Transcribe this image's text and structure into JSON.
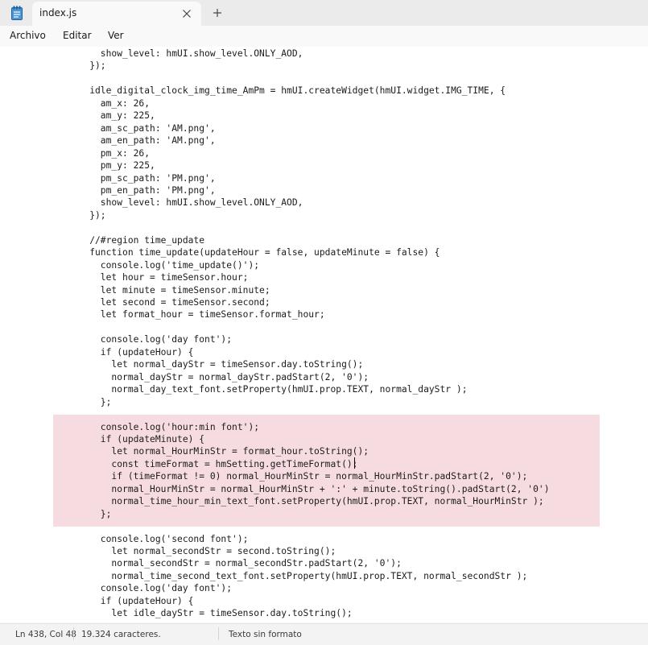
{
  "tab": {
    "title": "index.js"
  },
  "menu": {
    "items": [
      "Archivo",
      "Editar",
      "Ver"
    ]
  },
  "editor": {
    "lines": [
      "      show_level: hmUI.show_level.ONLY_AOD,",
      "    });",
      "",
      "    idle_digital_clock_img_time_AmPm = hmUI.createWidget(hmUI.widget.IMG_TIME, {",
      "      am_x: 26,",
      "      am_y: 225,",
      "      am_sc_path: 'AM.png',",
      "      am_en_path: 'AM.png',",
      "      pm_x: 26,",
      "      pm_y: 225,",
      "      pm_sc_path: 'PM.png',",
      "      pm_en_path: 'PM.png',",
      "      show_level: hmUI.show_level.ONLY_AOD,",
      "    });",
      "",
      "    //#region time_update",
      "    function time_update(updateHour = false, updateMinute = false) {",
      "      console.log('time_update()');",
      "      let hour = timeSensor.hour;",
      "      let minute = timeSensor.minute;",
      "      let second = timeSensor.second;",
      "      let format_hour = timeSensor.format_hour;",
      "",
      "      console.log('day font');",
      "      if (updateHour) {",
      "        let normal_dayStr = timeSensor.day.toString();",
      "        normal_dayStr = normal_dayStr.padStart(2, '0');",
      "        normal_day_text_font.setProperty(hmUI.prop.TEXT, normal_dayStr );",
      "      };",
      "",
      "      console.log('hour:min font');",
      "      if (updateMinute) {",
      "        let normal_HourMinStr = format_hour.toString();",
      "        const timeFormat = hmSetting.getTimeFormat();",
      "        if (timeFormat != 0) normal_HourMinStr = normal_HourMinStr.padStart(2, '0');",
      "        normal_HourMinStr = normal_HourMinStr + ':' + minute.toString().padStart(2, '0')",
      "        normal_time_hour_min_text_font.setProperty(hmUI.prop.TEXT, normal_HourMinStr );",
      "      };",
      "",
      "      console.log('second font');",
      "        let normal_secondStr = second.toString();",
      "        normal_secondStr = normal_secondStr.padStart(2, '0');",
      "        normal_time_second_text_font.setProperty(hmUI.prop.TEXT, normal_secondStr );",
      "      console.log('day font');",
      "      if (updateHour) {",
      "        let idle_dayStr = timeSensor.day.toString();"
    ],
    "highlight_color": "#f6dce0"
  },
  "status": {
    "position": "Ln 438, Col 48",
    "chars": "19.324 caracteres.",
    "format": "Texto sin formato"
  },
  "icons": {
    "app": "notepad-icon",
    "close": "close-icon",
    "add": "plus-icon"
  }
}
